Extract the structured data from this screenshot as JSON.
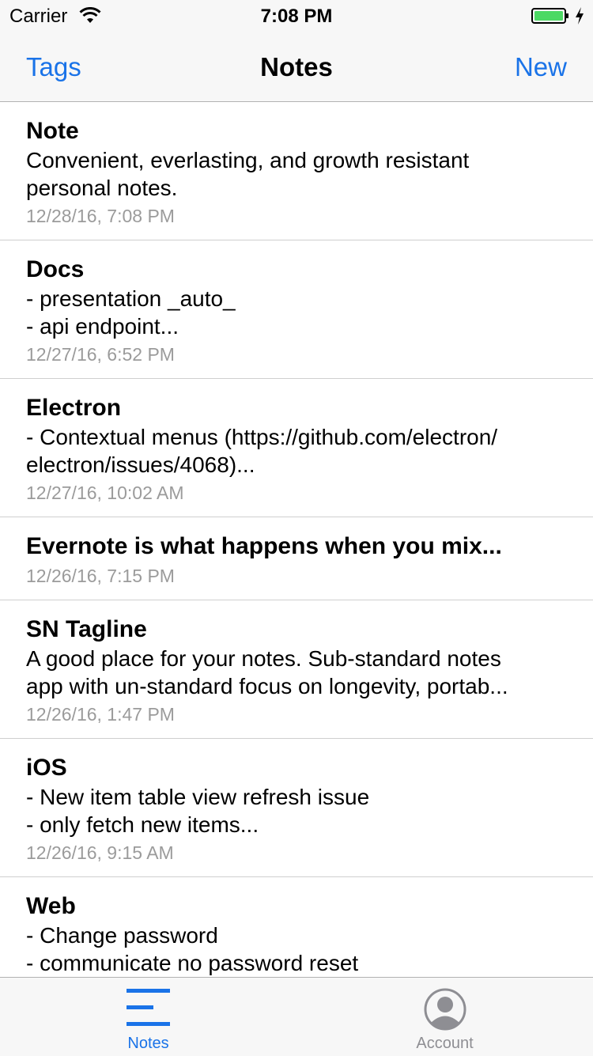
{
  "status_bar": {
    "carrier": "Carrier",
    "time": "7:08 PM",
    "battery_color": "#4cd964"
  },
  "nav": {
    "left_label": "Tags",
    "title": "Notes",
    "right_label": "New",
    "accent_color": "#1a73e8"
  },
  "notes": [
    {
      "title": "Note",
      "body": "Convenient, everlasting, and growth resistant\npersonal notes.",
      "date": "12/28/16, 7:08 PM"
    },
    {
      "title": "Docs",
      "body": "- presentation _auto_\n- api endpoint...",
      "date": "12/27/16, 6:52 PM"
    },
    {
      "title": "Electron",
      "body": "- Contextual menus (https://github.com/electron/\nelectron/issues/4068)...",
      "date": "12/27/16, 10:02 AM"
    },
    {
      "title": "Evernote is what happens when you mix...",
      "body": "",
      "date": "12/26/16, 7:15 PM"
    },
    {
      "title": "SN Tagline",
      "body": "A good place for your notes. Sub-standard notes\napp with un-standard focus on longevity, portab...",
      "date": "12/26/16, 1:47 PM"
    },
    {
      "title": "iOS",
      "body": "- New item table view refresh issue\n- only fetch new items...",
      "date": "12/26/16, 9:15 AM"
    },
    {
      "title": "Web",
      "body": "- Change password\n- communicate no password reset",
      "date": ""
    }
  ],
  "tab_bar": {
    "tabs": [
      {
        "label": "Notes",
        "icon": "notes-list-icon",
        "selected": true
      },
      {
        "label": "Account",
        "icon": "account-icon",
        "selected": false
      }
    ]
  }
}
